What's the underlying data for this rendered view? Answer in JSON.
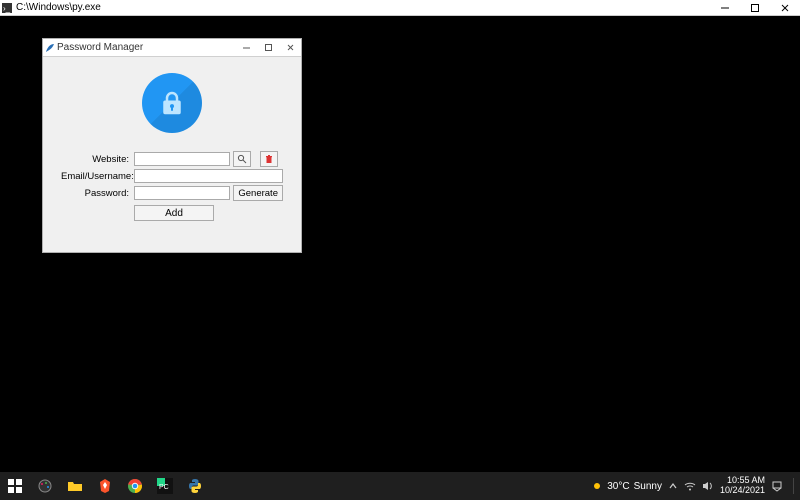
{
  "console": {
    "title": "C:\\Windows\\py.exe"
  },
  "pm": {
    "title": "Password Manager",
    "labels": {
      "website": "Website:",
      "email": "Email/Username:",
      "password": "Password:"
    },
    "values": {
      "website": "",
      "email": "",
      "password": ""
    },
    "buttons": {
      "generate": "Generate",
      "add": "Add"
    }
  },
  "taskbar": {
    "weather_temp": "30°C",
    "weather_desc": "Sunny",
    "time": "10:55 AM",
    "date": "10/24/2021"
  }
}
